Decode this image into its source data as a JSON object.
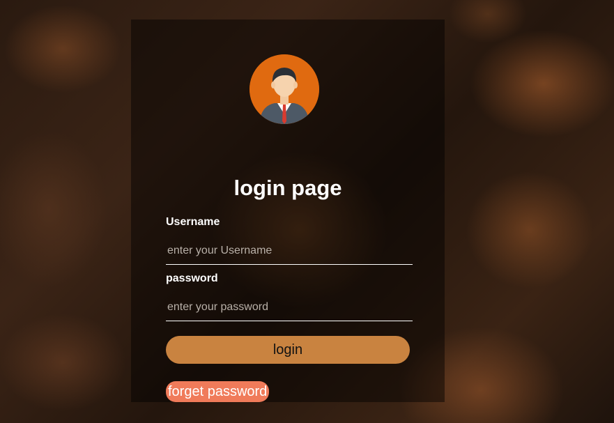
{
  "page": {
    "title": "login page"
  },
  "form": {
    "username_label": "Username",
    "username_placeholder": "enter your Username",
    "password_label": "password",
    "password_placeholder": "enter your password",
    "login_label": "login",
    "forget_label": "forget password"
  },
  "icons": {
    "avatar": "user-avatar-icon"
  },
  "colors": {
    "button": "#c98340",
    "forget_link": "#f07b5a",
    "avatar_bg": "#e06a10",
    "panel": "rgba(0,0,0,0.45)"
  }
}
